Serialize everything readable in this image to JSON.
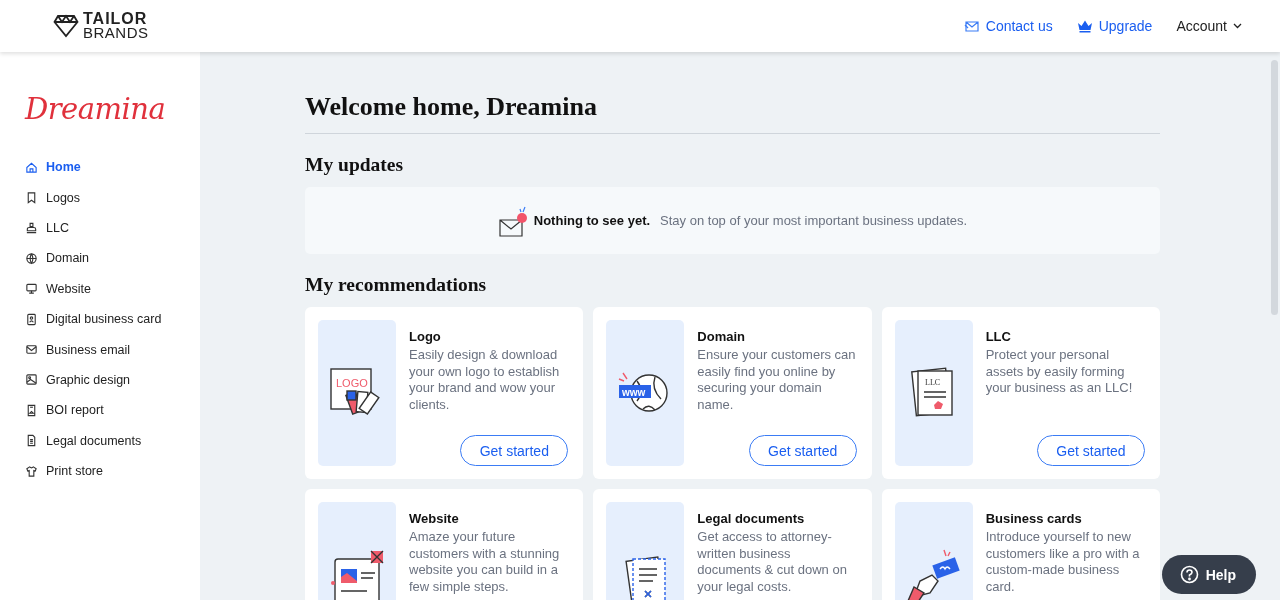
{
  "header": {
    "brand_top": "TAILOR",
    "brand_bottom": "BRANDS",
    "links": [
      {
        "label": "Contact us",
        "kind": "contact"
      },
      {
        "label": "Upgrade",
        "kind": "upgrade"
      },
      {
        "label": "Account",
        "kind": "menu"
      }
    ]
  },
  "sidebar": {
    "business_name": "Dreamina",
    "items": [
      {
        "label": "Home",
        "selected": true
      },
      {
        "label": "Logos",
        "selected": false
      },
      {
        "label": "LLC",
        "selected": false
      },
      {
        "label": "Domain",
        "selected": false
      },
      {
        "label": "Website",
        "selected": false
      },
      {
        "label": "Digital business card",
        "selected": false
      },
      {
        "label": "Business email",
        "selected": false
      },
      {
        "label": "Graphic design",
        "selected": false
      },
      {
        "label": "BOI report",
        "selected": false
      },
      {
        "label": "Legal documents",
        "selected": false
      },
      {
        "label": "Print store",
        "selected": false
      }
    ]
  },
  "main": {
    "title": "Welcome home, Dreamina",
    "updates": {
      "heading": "My updates",
      "empty_title": "Nothing to see yet.",
      "empty_text": "Stay on top of your most important business updates."
    },
    "recommendations": {
      "heading": "My recommendations",
      "cards": [
        {
          "title": "Logo",
          "illustration_text": "LOGO",
          "text": "Easily design & download your own logo to establish your brand and wow your clients.",
          "button": "Get started"
        },
        {
          "title": "Domain",
          "illustration_text": "www",
          "text": "Ensure your customers can easily find you online by securing your domain name.",
          "button": "Get started"
        },
        {
          "title": "LLC",
          "illustration_text": "LLC",
          "text": "Protect your personal assets by easily forming your business as an LLC!",
          "button": "Get started"
        },
        {
          "title": "Website",
          "text": "Amaze your future customers with a stunning website you can build in a few simple steps."
        },
        {
          "title": "Legal documents",
          "text": "Get access to attorney-written business documents & cut down on your legal costs."
        },
        {
          "title": "Business cards",
          "text": "Introduce yourself to new customers like a pro with a custom-made business card."
        }
      ]
    }
  },
  "help_button": "Help"
}
